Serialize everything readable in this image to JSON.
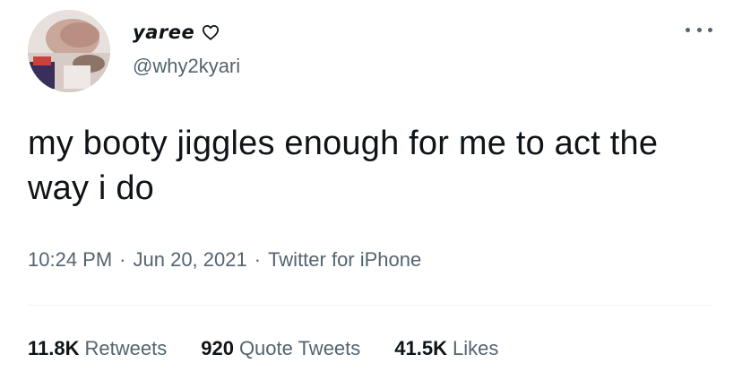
{
  "user": {
    "display_name": "yaree",
    "handle": "@why2kyari"
  },
  "tweet": {
    "text": "my booty jiggles enough for me to act the way i do",
    "time": "10:24 PM",
    "date": "Jun 20, 2021",
    "source": "Twitter for iPhone",
    "separator": "·"
  },
  "stats": {
    "retweets_count": "11.8K",
    "retweets_label": "Retweets",
    "quotes_count": "920",
    "quotes_label": "Quote Tweets",
    "likes_count": "41.5K",
    "likes_label": "Likes"
  },
  "icons": {
    "name_badge": "heart-outline-icon",
    "menu": "more-icon"
  },
  "colors": {
    "text_primary": "#0f1419",
    "text_secondary": "#536471",
    "divider": "#eff3f4"
  }
}
